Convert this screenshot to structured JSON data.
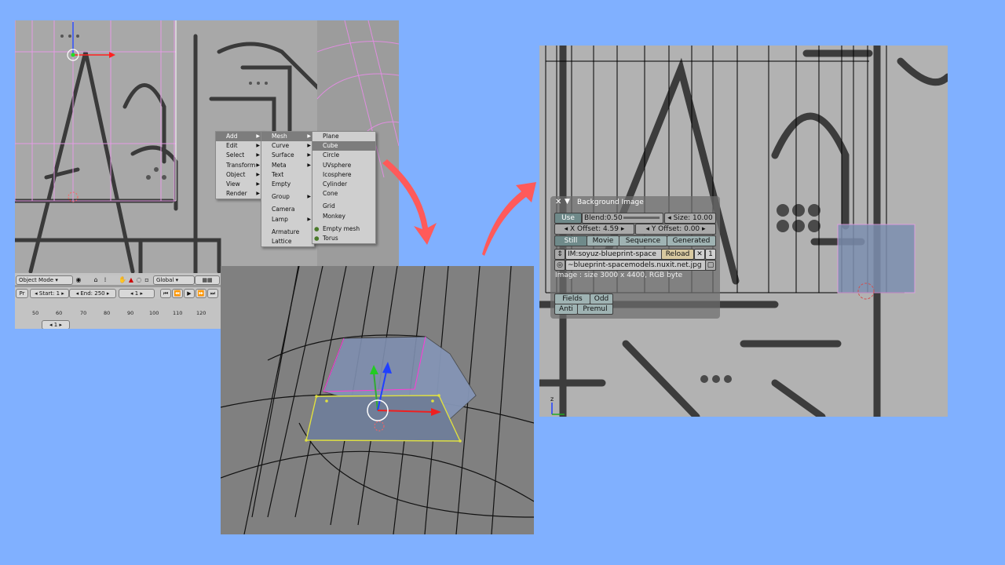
{
  "add_menu": {
    "items": [
      {
        "label": "Add",
        "highlighted": true,
        "submenu": true
      },
      {
        "label": "Edit",
        "submenu": true
      },
      {
        "label": "Select",
        "submenu": true
      },
      {
        "label": "Transform",
        "submenu": true
      },
      {
        "label": "Object",
        "submenu": true
      },
      {
        "label": "View",
        "submenu": true
      },
      {
        "label": "Render",
        "submenu": true
      }
    ]
  },
  "category_menu": {
    "items": [
      {
        "label": "Mesh",
        "highlighted": true,
        "submenu": true
      },
      {
        "label": "Curve",
        "submenu": true
      },
      {
        "label": "Surface",
        "submenu": true
      },
      {
        "label": "Meta",
        "submenu": true
      },
      {
        "label": "Text"
      },
      {
        "label": "Empty"
      },
      {
        "label": "Group",
        "submenu": true
      },
      {
        "label": "Camera"
      },
      {
        "label": "Lamp",
        "submenu": true
      },
      {
        "label": "Armature"
      },
      {
        "label": "Lattice"
      }
    ]
  },
  "mesh_menu": {
    "items": [
      {
        "label": "Plane"
      },
      {
        "label": "Cube",
        "highlighted": true
      },
      {
        "label": "Circle"
      },
      {
        "label": "UVsphere"
      },
      {
        "label": "Icosphere"
      },
      {
        "label": "Cylinder"
      },
      {
        "label": "Cone"
      },
      {
        "label": "Grid"
      },
      {
        "label": "Monkey"
      },
      {
        "label": "Empty mesh"
      },
      {
        "label": "Torus"
      }
    ]
  },
  "header": {
    "mode": "Object Mode",
    "orientation": "Global"
  },
  "timeline": {
    "pr_label": "Pr",
    "start": "Start: 1",
    "end": "End: 250",
    "frame": "1",
    "ruler": [
      "50",
      "60",
      "70",
      "80",
      "90",
      "100",
      "110",
      "120"
    ],
    "current": "1"
  },
  "bg_panel": {
    "title": "Background Image",
    "use": "Use",
    "blend": "Blend:0.50",
    "size": "Size: 10.00",
    "x_offset": "X Offset: 4.59",
    "y_offset": "Y Offset: 0.00",
    "source_tabs": [
      "Still",
      "Movie",
      "Sequence",
      "Generated"
    ],
    "image_name": "IM:soyuz-blueprint-space",
    "reload": "Reload",
    "close": "✕",
    "users": "1",
    "path": "~blueprint-spacemodels.nuxit.net.jpg",
    "info": "Image : size 3000 x 4400, RGB byte",
    "fields": "Fields",
    "odd": "Odd",
    "anti": "Anti",
    "premul": "Premul"
  },
  "axis_label": "z",
  "colors": {
    "background": "#80b0ff",
    "arrow": "#ff5a5a",
    "mesh_face": "#7d8fb0",
    "selected_edge": "#e0e040",
    "highlight": "#7d7d7d"
  }
}
